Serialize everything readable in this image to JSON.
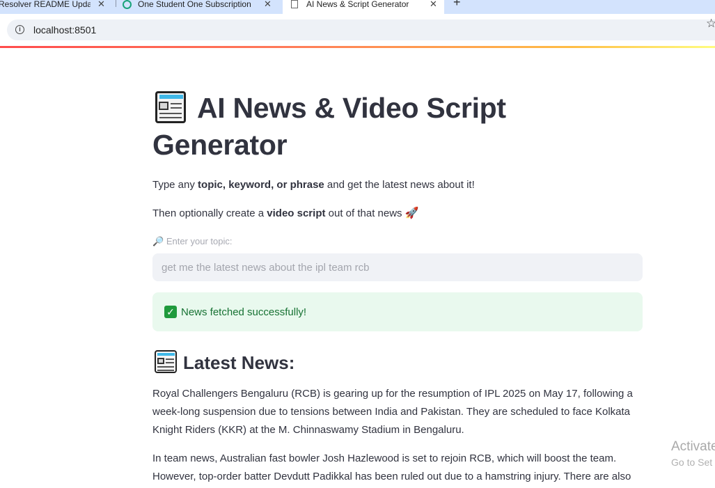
{
  "browser": {
    "tabs": [
      {
        "title": "Resolver README Updat",
        "active": false
      },
      {
        "title": "One Student One Subscription |",
        "active": false
      },
      {
        "title": "AI News & Script Generator",
        "active": true
      }
    ],
    "new_tab": "+",
    "url": "localhost:8501"
  },
  "app": {
    "title": "AI News & Video Script Generator",
    "intro": {
      "pre": "Type any ",
      "bold": "topic, keyword, or phrase",
      "post": " and get the latest news about it!"
    },
    "intro2": {
      "pre": "Then optionally create a ",
      "bold": "video script",
      "post": " out of that news ",
      "emoji": "🚀"
    },
    "input": {
      "label_icon": "🔎",
      "label": "Enter your topic:",
      "placeholder": "get me the latest news about the ipl team rcb"
    },
    "success": {
      "icon": "✓",
      "message": "News fetched successfully!",
      "color": "#177233"
    },
    "news_header": "Latest News:",
    "news": [
      "Royal Challengers Bengaluru (RCB) is gearing up for the resumption of IPL 2025 on May 17, following a week-long suspension due to tensions between India and Pakistan. They are scheduled to face Kolkata Knight Riders (KKR) at the M. Chinnaswamy Stadium in Bengaluru.",
      "In team news, Australian fast bowler Josh Hazlewood is set to rejoin RCB, which will boost the team. However, top-order batter Devdutt Padikkal has been ruled out due to a hamstring injury. There are also"
    ]
  },
  "os_overlay": {
    "line1": "Activate",
    "line2": "Go to Set"
  },
  "colors": {
    "accent_line": "#ff4b4b",
    "tab_bar": "#d3e3fd",
    "success_bg": "#e9f9ee"
  }
}
